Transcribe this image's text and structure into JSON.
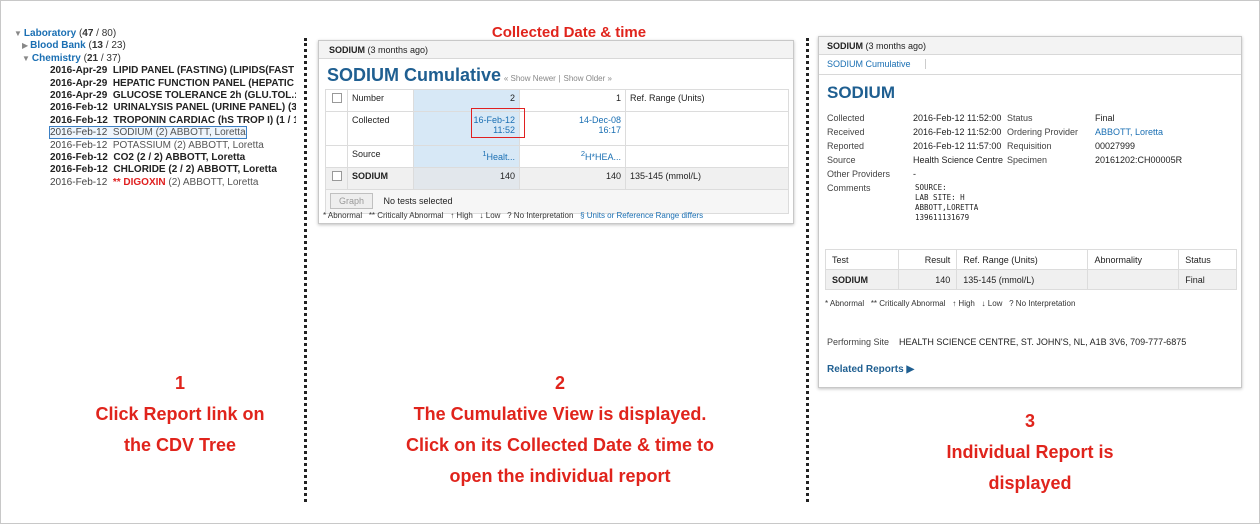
{
  "tree": {
    "laboratory": {
      "label": "Laboratory",
      "count_a": "47",
      "count_b": "80"
    },
    "blood_bank": {
      "label": "Blood Bank",
      "count_a": "13",
      "count_b": "23"
    },
    "chemistry": {
      "label": "Chemistry",
      "count_a": "21",
      "count_b": "37"
    },
    "reports": [
      {
        "date": "2016-Apr-29",
        "text": "LIPID PANEL (FASTING) (LIPIDS(FAST",
        "style": "bold"
      },
      {
        "date": "2016-Apr-29",
        "text": "HEPATIC FUNCTION PANEL (HEPATIC",
        "style": "bold"
      },
      {
        "date": "2016-Apr-29",
        "text": "GLUCOSE TOLERANCE 2h (GLU.TOL.:",
        "style": "bold"
      },
      {
        "date": "2016-Feb-12",
        "text": "URINALYSIS PANEL (URINE PANEL) (3",
        "style": "bold"
      },
      {
        "date": "2016-Feb-12",
        "text": "TROPONIN CARDIAC (hS TROP I) (1 / 1",
        "style": "bold"
      },
      {
        "date": "2016-Feb-12",
        "text": "SODIUM (2) ABBOTT, Loretta",
        "style": "selected"
      },
      {
        "date": "2016-Feb-12",
        "text": "POTASSIUM (2) ABBOTT, Loretta",
        "style": "normal"
      },
      {
        "date": "2016-Feb-12",
        "text": "CO2 (2 / 2) ABBOTT, Loretta",
        "style": "bold"
      },
      {
        "date": "2016-Feb-12",
        "text": "CHLORIDE (2 / 2) ABBOTT, Loretta",
        "style": "bold"
      },
      {
        "date": "2016-Feb-12",
        "flag": "** DIGOXIN",
        "text": "(2) ABBOTT, Loretta",
        "style": "critical"
      }
    ]
  },
  "callout": "Collected Date & time",
  "cumulative": {
    "header_name": "SODIUM",
    "header_age": "(3 months ago)",
    "title": "SODIUM Cumulative",
    "show_newer": "« Show Newer",
    "sep": "|",
    "show_older": "Show Older »",
    "number_label": "Number",
    "num_col1": "2",
    "num_col2": "1",
    "ref_header": "Ref. Range (Units)",
    "collected_label": "Collected",
    "col1_date": "16-Feb-12",
    "col1_time": "11:52",
    "col2_date": "14-Dec-08",
    "col2_time": "16:17",
    "source_label": "Source",
    "src1_sup": "1",
    "src1": "Healt...",
    "src2_sup": "2",
    "src2": "H*HEA...",
    "test_name": "SODIUM",
    "val1": "140",
    "val2": "140",
    "ref_range": "135-145 (mmol/L)",
    "graph_btn": "Graph",
    "no_tests": "No tests selected",
    "legend": [
      "* Abnormal",
      "** Critically Abnormal",
      "↑ High",
      "↓ Low",
      "? No Interpretation",
      "§ Units or Reference Range differs"
    ]
  },
  "report": {
    "header_name": "SODIUM",
    "header_age": "(3 months ago)",
    "breadcrumb": "SODIUM Cumulative",
    "title": "SODIUM",
    "left": [
      {
        "k": "Collected",
        "v": "2016-Feb-12 11:52:00"
      },
      {
        "k": "Received",
        "v": "2016-Feb-12 11:52:00"
      },
      {
        "k": "Reported",
        "v": "2016-Feb-12 11:57:00"
      },
      {
        "k": "Source",
        "v": "Health Science Centre"
      },
      {
        "k": "Other Providers",
        "v": "-"
      }
    ],
    "right": [
      {
        "k": "Status",
        "v": "Final"
      },
      {
        "k": "Ordering Provider",
        "v": "ABBOTT, Loretta"
      },
      {
        "k": "Requisition",
        "v": "00027999"
      },
      {
        "k": "Specimen",
        "v": "20161202:CH00005R"
      }
    ],
    "comments_label": "Comments",
    "comments": "SOURCE:\nLAB SITE: H\nABBOTT,LORETTA\n139611131679",
    "table_headers": [
      "Test",
      "Result",
      "Ref. Range (Units)",
      "Abnormality",
      "Status"
    ],
    "row": [
      "SODIUM",
      "140",
      "135-145 (mmol/L)",
      "",
      "Final"
    ],
    "legend": [
      "* Abnormal",
      "** Critically Abnormal",
      "↑ High",
      "↓ Low",
      "? No Interpretation"
    ],
    "performing_label": "Performing Site",
    "performing": "HEALTH SCIENCE CENTRE, ST. JOHN'S, NL, A1B 3V6, 709-777-6875",
    "related": "Related Reports ▶"
  },
  "captions": {
    "c1": [
      "1",
      "Click Report link on",
      "the CDV Tree"
    ],
    "c2": [
      "2",
      "The Cumulative View is displayed.",
      "Click on its Collected Date & time to",
      "open the individual report"
    ],
    "c3": [
      "3",
      "Individual Report is",
      "displayed"
    ]
  },
  "colors": {
    "accent_red": "#e0241c",
    "link_blue": "#1a6fb3",
    "title_blue": "#1f5f91"
  }
}
